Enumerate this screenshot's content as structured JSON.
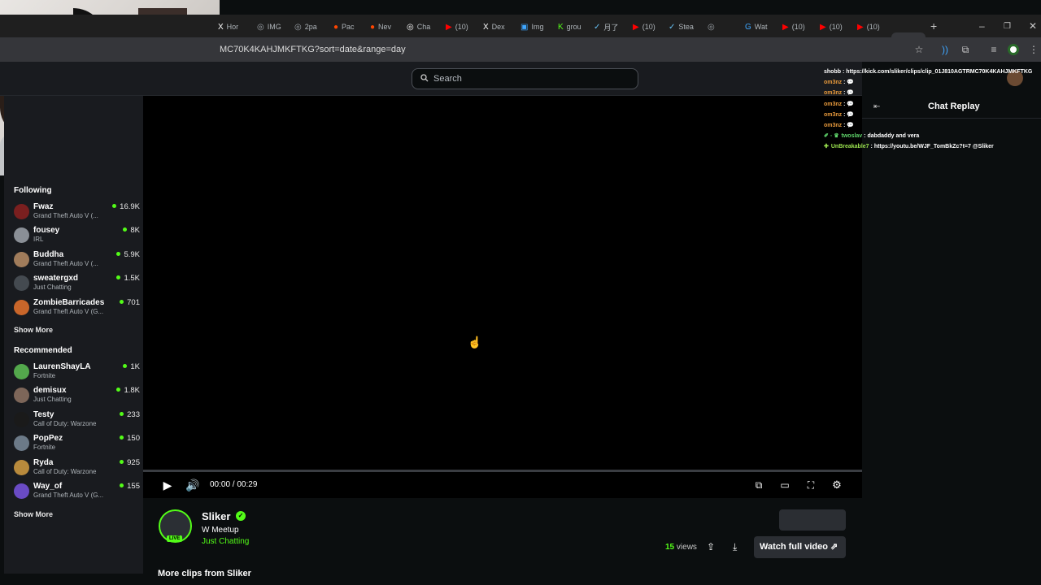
{
  "browser": {
    "tabs": [
      {
        "label": "Hor",
        "color": "#ffffff",
        "glyph": "X"
      },
      {
        "label": "IMG",
        "color": "#9aa0a6",
        "glyph": "◎"
      },
      {
        "label": "2pa",
        "color": "#9aa0a6",
        "glyph": "◎"
      },
      {
        "label": "Pac",
        "color": "#ff4500",
        "glyph": "●"
      },
      {
        "label": "Nev",
        "color": "#ff4500",
        "glyph": "●"
      },
      {
        "label": "Cha",
        "color": "#ffffff",
        "glyph": "◎"
      },
      {
        "label": "(10)",
        "color": "#ff0000",
        "glyph": "▶"
      },
      {
        "label": "Dex",
        "color": "#ffffff",
        "glyph": "X"
      },
      {
        "label": "Img",
        "color": "#3ea6ff",
        "glyph": "▣"
      },
      {
        "label": "grou",
        "color": "#53fc18",
        "glyph": "K"
      },
      {
        "label": "月了",
        "color": "#66c0f4",
        "glyph": "✓"
      },
      {
        "label": "(10)",
        "color": "#ff0000",
        "glyph": "▶"
      },
      {
        "label": "Stea",
        "color": "#66c0f4",
        "glyph": "✓"
      },
      {
        "label": "",
        "color": "#9aa0a6",
        "glyph": "◎"
      },
      {
        "label": "Wat",
        "color": "#3ea6ff",
        "glyph": "G"
      },
      {
        "label": "(10)",
        "color": "#ff0000",
        "glyph": "▶"
      },
      {
        "label": "(10)",
        "color": "#ff0000",
        "glyph": "▶"
      },
      {
        "label": "(10)",
        "color": "#ff0000",
        "glyph": "▶"
      }
    ],
    "active_tab_glyph": "K",
    "close_glyph": "✕",
    "new_tab_glyph": "+",
    "url": "MC70K4KAHJMKFTKG?sort=date&range=day"
  },
  "kick": {
    "search_placeholder": "Search"
  },
  "sidebar": {
    "following_title": "Following",
    "following": [
      {
        "name": "Fwaz",
        "category": "Grand Theft Auto V (...",
        "viewers": "16.9K",
        "avatar": "#7a1f1f"
      },
      {
        "name": "fousey",
        "category": "IRL",
        "viewers": "8K",
        "avatar": "#8a8f96"
      },
      {
        "name": "Buddha",
        "category": "Grand Theft Auto V (...",
        "viewers": "5.9K",
        "avatar": "#a07c5b"
      },
      {
        "name": "sweatergxd",
        "category": "Just Chatting",
        "viewers": "1.5K",
        "avatar": "#444a50"
      },
      {
        "name": "ZombieBarricades",
        "category": "Grand Theft Auto V (G...",
        "viewers": "701",
        "avatar": "#c9662a"
      }
    ],
    "show_more_1": "Show More",
    "recommended_title": "Recommended",
    "recommended": [
      {
        "name": "LaurenShayLA",
        "category": "Fortnite",
        "viewers": "1K",
        "avatar": "#53a84c"
      },
      {
        "name": "demisux",
        "category": "Just Chatting",
        "viewers": "1.8K",
        "avatar": "#7d6659"
      },
      {
        "name": "Testy",
        "category": "Call of Duty: Warzone",
        "viewers": "233",
        "avatar": "#1a1a1a"
      },
      {
        "name": "PopPez",
        "category": "Fortnite",
        "viewers": "150",
        "avatar": "#6c7a88"
      },
      {
        "name": "Ryda",
        "category": "Call of Duty: Warzone",
        "viewers": "925",
        "avatar": "#b88a3c"
      },
      {
        "name": "Way_of",
        "category": "Grand Theft Auto V (G...",
        "viewers": "155",
        "avatar": "#6a4bc4"
      }
    ],
    "show_more_2": "Show More"
  },
  "player": {
    "time": "00:00 / 00:29"
  },
  "clip": {
    "streamer": "Sliker",
    "title": "W Meetup",
    "category": "Just Chatting",
    "live_badge": "LIVE",
    "views_count": "15",
    "views_label": "views",
    "watch_full": "Watch full video",
    "more_clips": "More clips from Sliker"
  },
  "chat": {
    "title": "Chat Replay",
    "overlay": [
      {
        "user": "shobb",
        "text": "https://kick.com/sliker/clips/clip_01J810AGTRMC70K4KAHJMKFTKG",
        "color": "#ffffff",
        "badge": ""
      },
      {
        "user": "om3nz",
        "text": "💬",
        "color": "#e89a3c",
        "badge": ""
      },
      {
        "user": "om3nz",
        "text": "💬",
        "color": "#e89a3c",
        "badge": ""
      },
      {
        "user": "om3nz",
        "text": "💬",
        "color": "#e89a3c",
        "badge": ""
      },
      {
        "user": "om3nz",
        "text": "💬",
        "color": "#e89a3c",
        "badge": ""
      },
      {
        "user": "om3nz",
        "text": "💬",
        "color": "#e89a3c",
        "badge": ""
      },
      {
        "user": "twoslav",
        "text": "dabdaddy and vera",
        "color": "#5fd36a",
        "badge": "✐ ◦ ♛"
      },
      {
        "user": "UnBreakable7",
        "text": "https://youtu.be/WJF_TomBkZc?t=7 @Sliker",
        "color": "#9be34f",
        "badge": "✚"
      }
    ]
  }
}
